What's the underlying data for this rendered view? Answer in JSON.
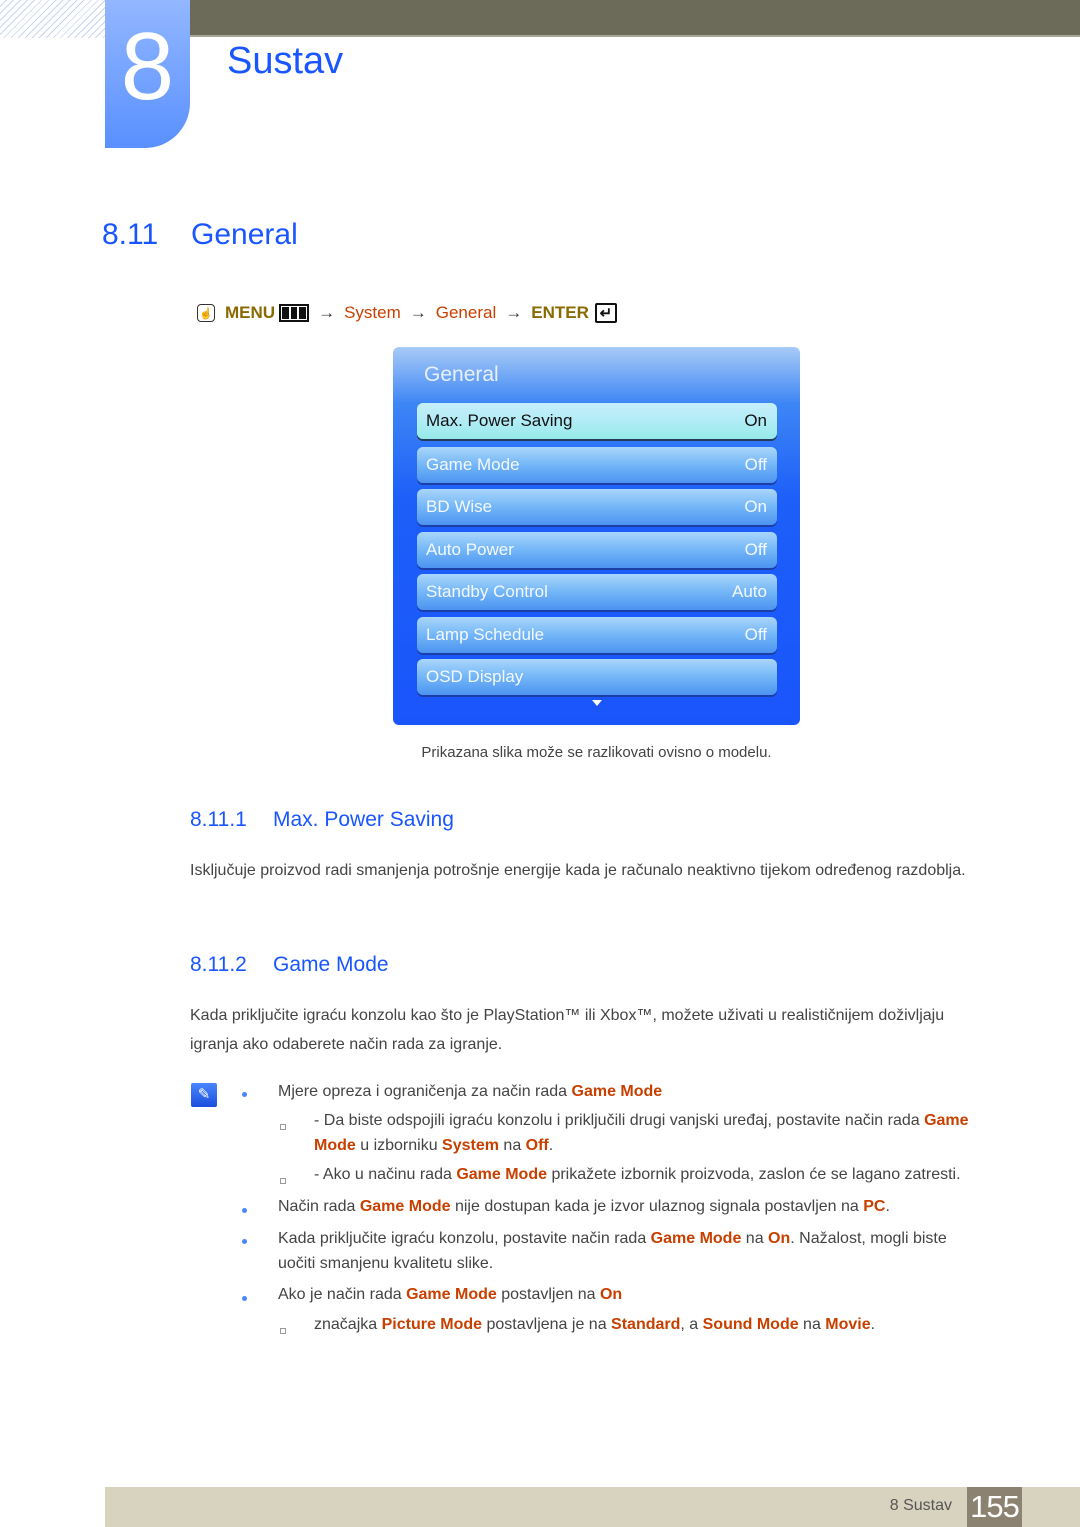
{
  "chapter": {
    "number": "8",
    "title": "Sustav"
  },
  "section": {
    "number": "8.11",
    "title": "General"
  },
  "menu_path": {
    "menu_label": "MENU",
    "steps": [
      "System",
      "General"
    ],
    "enter_label": "ENTER",
    "arrow": "→"
  },
  "osd": {
    "title": "General",
    "items": [
      {
        "label": "Max. Power Saving",
        "value": "On",
        "selected": true
      },
      {
        "label": "Game Mode",
        "value": "Off"
      },
      {
        "label": "BD Wise",
        "value": "On"
      },
      {
        "label": "Auto Power",
        "value": "Off"
      },
      {
        "label": "Standby Control",
        "value": "Auto"
      },
      {
        "label": "Lamp Schedule",
        "value": "Off"
      },
      {
        "label": "OSD Display",
        "value": ""
      }
    ]
  },
  "image_caption": "Prikazana slika može se razlikovati ovisno o modelu.",
  "subsections": [
    {
      "number": "8.11.1",
      "title": "Max. Power Saving",
      "body": "Isključuje proizvod radi smanjenja potrošnje energije kada je računalo neaktivno tijekom određenog razdoblja."
    },
    {
      "number": "8.11.2",
      "title": "Game Mode",
      "body": "Kada priključite igraću konzolu kao što je PlayStation™ ili Xbox™, možete uživati u realističnijem doživljaju igranja ako odaberete način rada za igranje."
    }
  ],
  "notes": {
    "n1": {
      "text": "Mjere opreza i ograničenja za način rada ",
      "hl": "Game Mode"
    },
    "n1a": {
      "t1": "- Da biste odspojili igraću konzolu i priključili drugi vanjski uređaj, postavite način rada ",
      "h1": "Game",
      "h1b": "Mode",
      "t2": " u izborniku ",
      "h2": "System",
      "t3": " na ",
      "h3": "Off",
      "t4": "."
    },
    "n1b": {
      "t1": "- Ako u načinu rada ",
      "h1": "Game Mode",
      "t2": " prikažete izbornik proizvoda, zaslon će se lagano zatresti."
    },
    "n2": {
      "t1": "Način rada ",
      "h1": "Game Mode",
      "t2": " nije dostupan kada je izvor ulaznog signala postavljen na ",
      "h2": "PC",
      "t3": "."
    },
    "n3": {
      "t1": "Kada priključite igraću konzolu, postavite način rada ",
      "h1": "Game Mode",
      "t2": " na ",
      "h2": "On",
      "t3": ". Nažalost, mogli biste",
      "t4": "uočiti smanjenu kvalitetu slike."
    },
    "n4": {
      "t1": "Ako je način rada ",
      "h1": "Game Mode",
      "t2": " postavljen na ",
      "h2": "On"
    },
    "n4a": {
      "t1": "značajka ",
      "h1": "Picture Mode",
      "t2": " postavljena je na ",
      "h2": "Standard",
      "t3": ", a ",
      "h3": "Sound Mode",
      "t4": " na ",
      "h4": "Movie",
      "t5": "."
    }
  },
  "footer": {
    "chapter_label": "8 Sustav",
    "page": "155"
  }
}
